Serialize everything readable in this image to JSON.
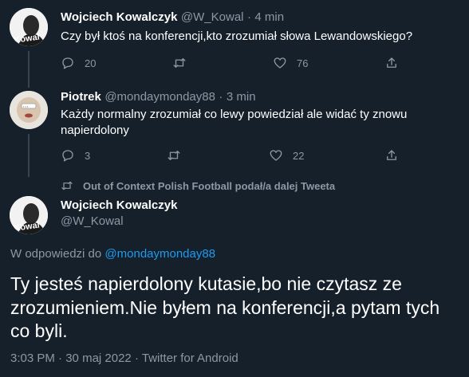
{
  "tweet1": {
    "author_name": "Wojciech Kowalczyk",
    "handle": "@W_Kowal",
    "time": "4 min",
    "text": "Czy był ktoś na konferencji,kto zrozumiał słowa Lewandowskiego?",
    "replies": "20",
    "likes": "76",
    "avatar_label": "Kowal"
  },
  "tweet2": {
    "author_name": "Piotrek",
    "handle": "@mondaymonday88",
    "time": "3 min",
    "text_line1": "Każdy normalny zrozumiał co lewy powiedział ale widać ty znowu",
    "text_line2": "napierdolony",
    "replies": "3",
    "likes": "22"
  },
  "retweet_notice": "Out of Context Polish Football podał/a dalej Tweeta",
  "main_tweet": {
    "author_name": "Wojciech Kowalczyk",
    "handle": "@W_Kowal",
    "avatar_label": "Kowal",
    "reply_prefix": "W odpowiedzi do",
    "reply_mention": "@mondaymonday88",
    "text_line1": "Ty jesteś napierdolony kutasie,bo nie czytasz ze",
    "text_line2": "zrozumieniem.Nie byłem na konferencji,a pytam tych",
    "text_line3": "co byli.",
    "time": "3:03 PM",
    "date": "30 maj 2022",
    "source": "Twitter for Android"
  },
  "separator": "·",
  "colors": {
    "background": "#15202b",
    "muted": "#8b98a5",
    "link": "#1d9bf0",
    "line": "#38444d"
  }
}
